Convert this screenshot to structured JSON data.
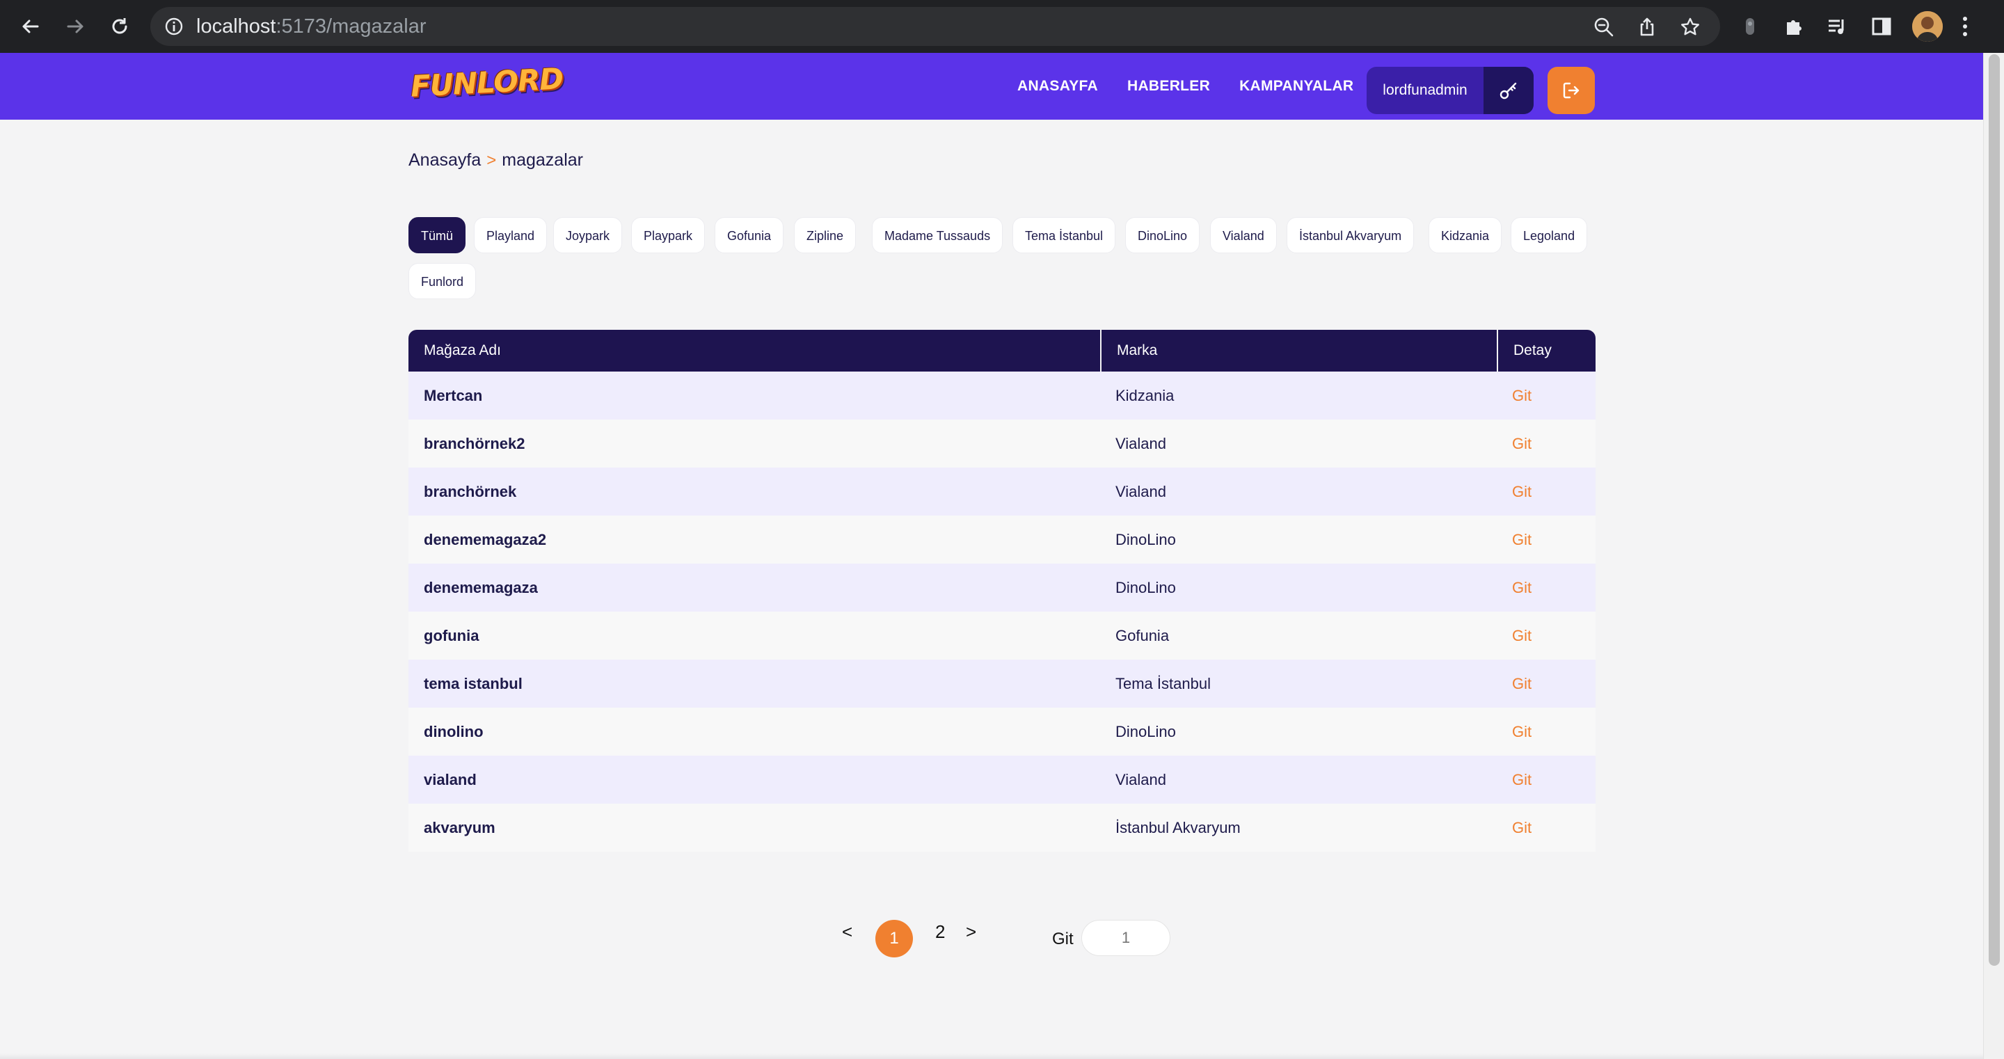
{
  "browser": {
    "url_host": "localhost",
    "url_path": ":5173/magazalar"
  },
  "colors": {
    "nav_bg": "#5b33e9",
    "dark": "#1e1450",
    "accent": "#f08030",
    "row_tint": "#efedfd"
  },
  "header": {
    "logo": "FUNLORD",
    "nav": [
      "ANASAYFA",
      "HABERLER",
      "KAMPANYALAR"
    ],
    "username": "lordfunadmin",
    "key_icon": "key-icon",
    "logout_icon": "logout-icon"
  },
  "breadcrumb": {
    "home": "Anasayfa",
    "separator": ">",
    "current": "magazalar"
  },
  "filters": {
    "active": "Tümü",
    "items": [
      "Tümü",
      "Playland",
      "Joypark",
      "Playpark",
      "Gofunia",
      "Zipline",
      "Madame Tussauds",
      "Tema İstanbul",
      "DinoLino",
      "Vialand",
      "İstanbul Akvaryum",
      "Kidzania",
      "Legoland",
      "Funlord"
    ]
  },
  "table": {
    "columns": [
      "Mağaza Adı",
      "Marka",
      "Detay"
    ],
    "rows": [
      {
        "name": "Mertcan",
        "brand": "Kidzania",
        "detail": "Git"
      },
      {
        "name": "branchörnek2",
        "brand": "Vialand",
        "detail": "Git"
      },
      {
        "name": "branchörnek",
        "brand": "Vialand",
        "detail": "Git"
      },
      {
        "name": "denememagaza2",
        "brand": "DinoLino",
        "detail": "Git"
      },
      {
        "name": "denememagaza",
        "brand": "DinoLino",
        "detail": "Git"
      },
      {
        "name": "gofunia",
        "brand": "Gofunia",
        "detail": "Git"
      },
      {
        "name": "tema istanbul",
        "brand": "Tema İstanbul",
        "detail": "Git"
      },
      {
        "name": "dinolino",
        "brand": "DinoLino",
        "detail": "Git"
      },
      {
        "name": "vialand",
        "brand": "Vialand",
        "detail": "Git"
      },
      {
        "name": "akvaryum",
        "brand": "İstanbul Akvaryum",
        "detail": "Git"
      }
    ]
  },
  "pagination": {
    "prev": "<",
    "pages": [
      "1",
      "2"
    ],
    "current": "1",
    "next": ">",
    "goto_label": "Git",
    "goto_placeholder": "1"
  }
}
